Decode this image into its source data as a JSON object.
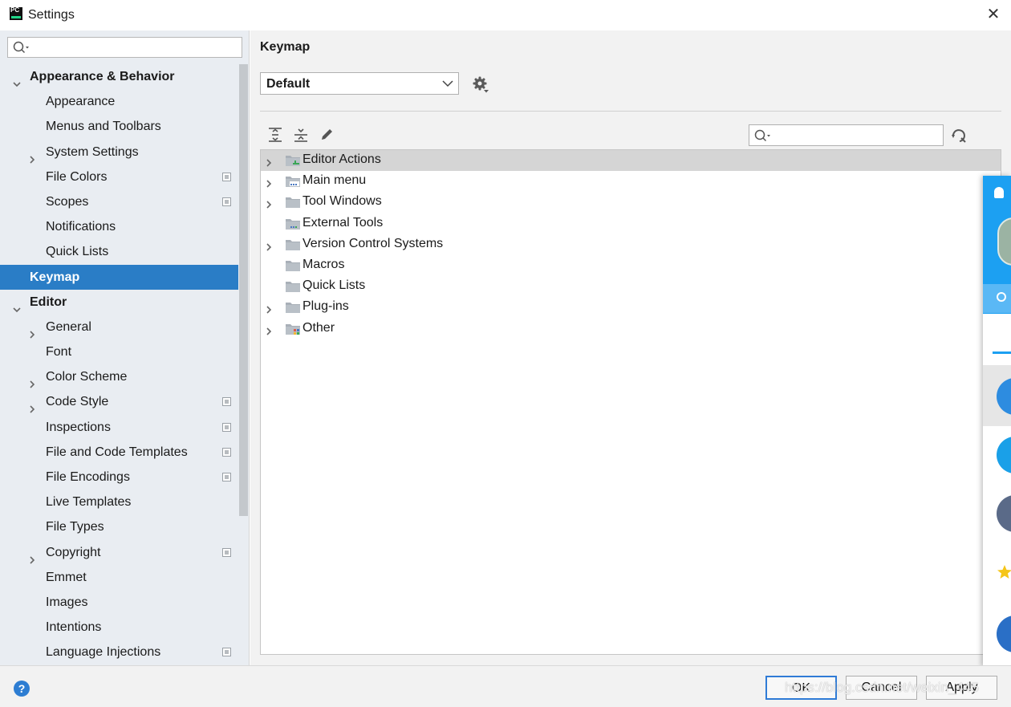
{
  "window": {
    "title": "Settings",
    "app_icon_text": "PC",
    "close_glyph": "✕"
  },
  "sidebar": {
    "search_placeholder": "",
    "items": [
      {
        "label": "Appearance & Behavior",
        "level": 0,
        "expanded": true,
        "icon": "chevron-down-icon"
      },
      {
        "label": "Appearance",
        "level": 1
      },
      {
        "label": "Menus and Toolbars",
        "level": 1
      },
      {
        "label": "System Settings",
        "level": 1,
        "collapsed": true,
        "icon": "chevron-right-icon"
      },
      {
        "label": "File Colors",
        "level": 1,
        "project_icon": true
      },
      {
        "label": "Scopes",
        "level": 1,
        "project_icon": true
      },
      {
        "label": "Notifications",
        "level": 1
      },
      {
        "label": "Quick Lists",
        "level": 1
      },
      {
        "label": "Keymap",
        "level": 0,
        "selected": true
      },
      {
        "label": "Editor",
        "level": 0,
        "expanded": true,
        "icon": "chevron-down-icon"
      },
      {
        "label": "General",
        "level": 1,
        "collapsed": true,
        "icon": "chevron-right-icon"
      },
      {
        "label": "Font",
        "level": 1
      },
      {
        "label": "Color Scheme",
        "level": 1,
        "collapsed": true,
        "icon": "chevron-right-icon"
      },
      {
        "label": "Code Style",
        "level": 1,
        "collapsed": true,
        "icon": "chevron-right-icon",
        "project_icon": true
      },
      {
        "label": "Inspections",
        "level": 1,
        "project_icon": true
      },
      {
        "label": "File and Code Templates",
        "level": 1,
        "project_icon": true
      },
      {
        "label": "File Encodings",
        "level": 1,
        "project_icon": true
      },
      {
        "label": "Live Templates",
        "level": 1
      },
      {
        "label": "File Types",
        "level": 1
      },
      {
        "label": "Copyright",
        "level": 1,
        "collapsed": true,
        "icon": "chevron-right-icon",
        "project_icon": true
      },
      {
        "label": "Emmet",
        "level": 1
      },
      {
        "label": "Images",
        "level": 1
      },
      {
        "label": "Intentions",
        "level": 1
      },
      {
        "label": "Language Injections",
        "level": 1,
        "project_icon": true
      }
    ]
  },
  "main": {
    "title": "Keymap",
    "scheme_value": "Default",
    "search_placeholder": "",
    "toolbar_icons": [
      "expand-all-icon",
      "collapse-all-icon",
      "edit-pencil-icon"
    ],
    "tree": [
      {
        "label": "Editor Actions",
        "has_children": true,
        "selected": true,
        "icon": "folder-editor-icon"
      },
      {
        "label": "Main menu",
        "has_children": true,
        "icon": "folder-menu-icon"
      },
      {
        "label": "Tool Windows",
        "has_children": true,
        "icon": "folder-icon"
      },
      {
        "label": "External Tools",
        "has_children": false,
        "icon": "folder-tools-icon"
      },
      {
        "label": "Version Control Systems",
        "has_children": true,
        "icon": "folder-icon"
      },
      {
        "label": "Macros",
        "has_children": false,
        "icon": "folder-icon"
      },
      {
        "label": "Quick Lists",
        "has_children": false,
        "icon": "folder-icon"
      },
      {
        "label": "Plug-ins",
        "has_children": true,
        "icon": "folder-icon"
      },
      {
        "label": "Other",
        "has_children": true,
        "icon": "folder-other-icon"
      }
    ]
  },
  "footer": {
    "help_glyph": "?",
    "ok_label": "OK",
    "cancel_label": "Cancel",
    "apply_label": "Apply",
    "watermark": "https://blog.csdn.net/weixin_445"
  },
  "colors": {
    "selected_bg": "#2a7dc6",
    "sidebar_bg": "#e9edf2",
    "accent_blue": "#1ca0f2"
  }
}
